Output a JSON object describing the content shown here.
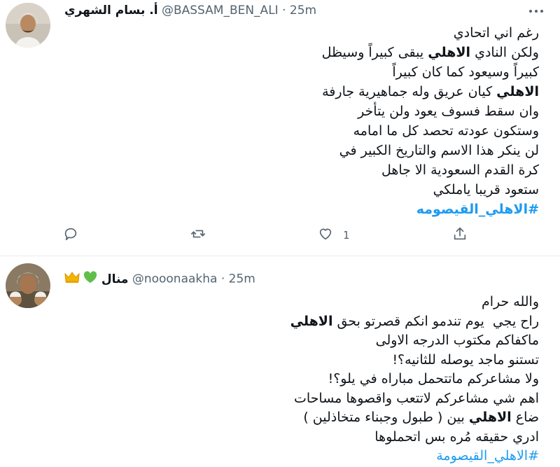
{
  "tweets": [
    {
      "name": "أ. بسام الشهري",
      "handle": "@BASSAM_BEN_ALI",
      "separator": "·",
      "time": "25m",
      "lines": [
        {
          "parts": [
            {
              "text": "رغم اني اتحادي",
              "bold": false
            }
          ]
        },
        {
          "parts": [
            {
              "text": "ولكن النادي ",
              "bold": false
            },
            {
              "text": "الاهلي",
              "bold": true
            },
            {
              "text": " يبقى كبيراً وسيظل",
              "bold": false
            }
          ]
        },
        {
          "parts": [
            {
              "text": "كبيراً وسيعود كما كان كبيراً",
              "bold": false
            }
          ]
        },
        {
          "parts": [
            {
              "text": "الاهلي",
              "bold": true
            },
            {
              "text": " كيان عريق وله جماهيرية جارفة",
              "bold": false
            }
          ]
        },
        {
          "parts": [
            {
              "text": "وان سقط فسوف يعود ولن يتأخر",
              "bold": false
            }
          ]
        },
        {
          "parts": [
            {
              "text": "وستكون عودته تحصد كل ما امامه",
              "bold": false
            }
          ]
        },
        {
          "parts": [
            {
              "text": "لن ينكر هذا الاسم والتاريخ الكبير في",
              "bold": false
            }
          ]
        },
        {
          "parts": [
            {
              "text": "كرة القدم السعودية الا جاهل",
              "bold": false
            }
          ]
        },
        {
          "parts": [
            {
              "text": "ستعود قريبا ياملكي",
              "bold": false
            }
          ]
        }
      ],
      "hashtag": "#الاهلي_القيصومه",
      "actions": {
        "reply_icon": "reply-icon",
        "retweet_icon": "retweet-icon",
        "like_icon": "heart-icon",
        "like_count": "1",
        "share_icon": "share-icon"
      }
    },
    {
      "name": "منال",
      "badges": [
        "green-heart-icon",
        "crown-icon"
      ],
      "handle": "@nooonaakha",
      "separator": "·",
      "time": "25m",
      "lines": [
        {
          "parts": [
            {
              "text": "والله حرام",
              "bold": false
            }
          ]
        },
        {
          "parts": [
            {
              "text": "راح يجي  يوم تندمو انكم قصرتو بحق ",
              "bold": false
            },
            {
              "text": "الاهلي",
              "bold": true
            }
          ]
        },
        {
          "parts": [
            {
              "text": "ماكفاكم مكتوب الدرجه الاولى",
              "bold": false
            }
          ]
        },
        {
          "parts": [
            {
              "text": "تستنو ماجد يوصله للثانيه؟!",
              "bold": false
            }
          ]
        },
        {
          "parts": [
            {
              "text": "ولا مشاعركم ماتتحمل مباراه في يلو؟!",
              "bold": false
            }
          ]
        },
        {
          "parts": [
            {
              "text": "اهم شي مشاعركم لاتتعب واقصوها مساحات",
              "bold": false
            }
          ]
        },
        {
          "parts": [
            {
              "text": "ضاع ",
              "bold": false
            },
            {
              "text": "الاهلي",
              "bold": true
            },
            {
              "text": " بين ( طبول وجبناء متخاذلين )",
              "bold": false
            }
          ]
        },
        {
          "parts": [
            {
              "text": "ادري حقيقه مُره بس اتحملوها",
              "bold": false
            }
          ]
        }
      ],
      "hashtag": "#الاهلي_القيصومة"
    }
  ],
  "colors": {
    "accent": "#1d9bf0",
    "secondary_text": "#536471",
    "divider": "#e6ecf0",
    "heart_badge": "#5fbf4a",
    "crown_badge": "#f5b400"
  }
}
